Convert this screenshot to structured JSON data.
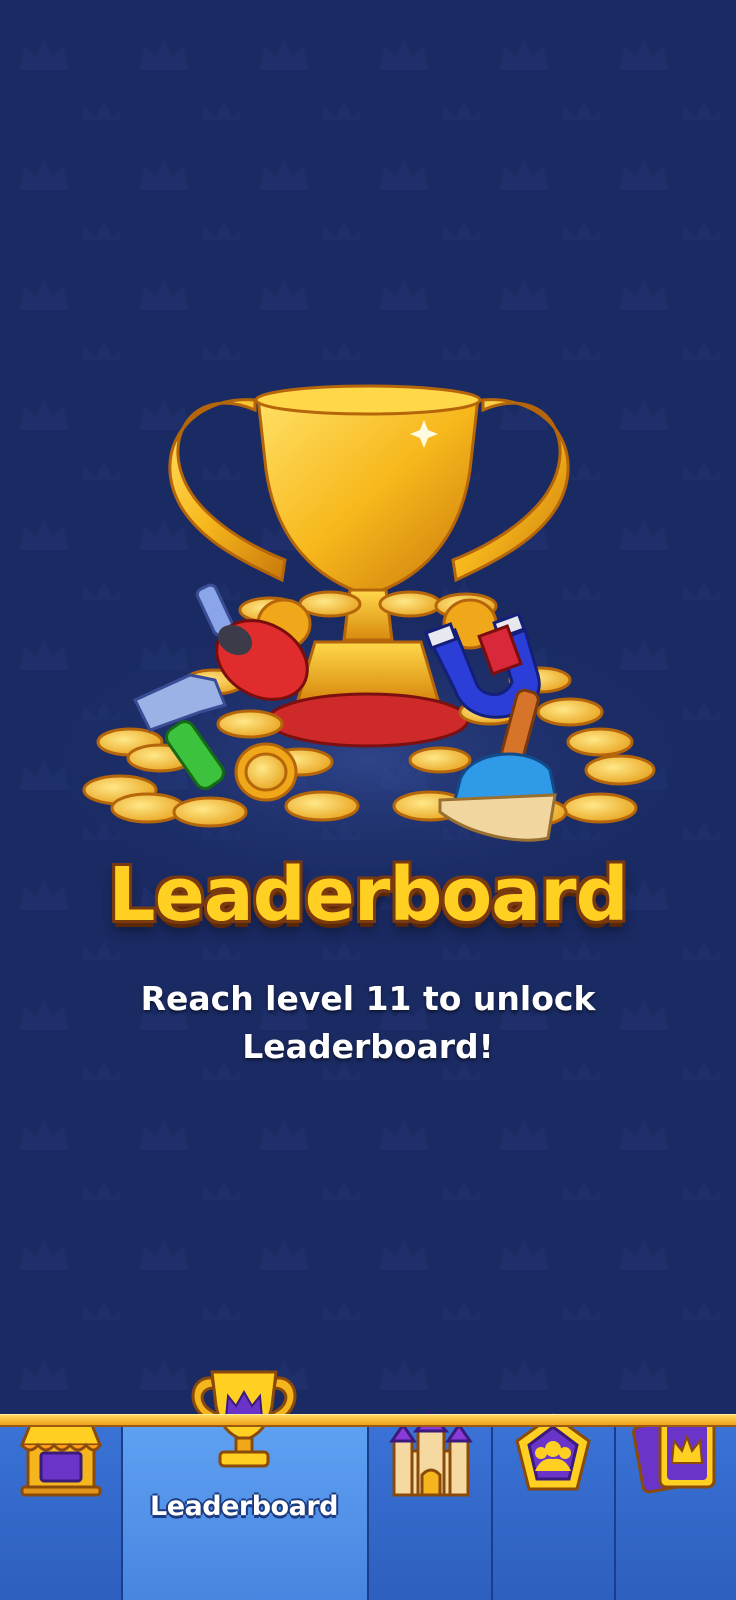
{
  "screen": {
    "title": "Leaderboard",
    "message": "Reach level 11 to unlock Leaderboard!"
  },
  "colors": {
    "background": "#1a2a62",
    "title_fill": "#ffcf22",
    "title_outline": "#7a3a0e",
    "nav_blue": "#2f64c8",
    "nav_active": "#5ea0f2",
    "gold": "#f5b51d",
    "purple": "#6a34c8"
  },
  "hero": {
    "icons": [
      "trophy-icon",
      "coin-pile-icon",
      "drill-icon",
      "hammer-icon",
      "magnet-icon",
      "broom-icon"
    ]
  },
  "nav": {
    "tabs": [
      {
        "id": "shop",
        "icon": "shop-stall-icon",
        "label": ""
      },
      {
        "id": "leaderboard",
        "icon": "trophy-crown-icon",
        "label": "Leaderboard",
        "active": true
      },
      {
        "id": "home",
        "icon": "castle-icon",
        "label": ""
      },
      {
        "id": "team",
        "icon": "team-badge-icon",
        "label": ""
      },
      {
        "id": "collection",
        "icon": "crown-cards-icon",
        "label": ""
      }
    ]
  }
}
